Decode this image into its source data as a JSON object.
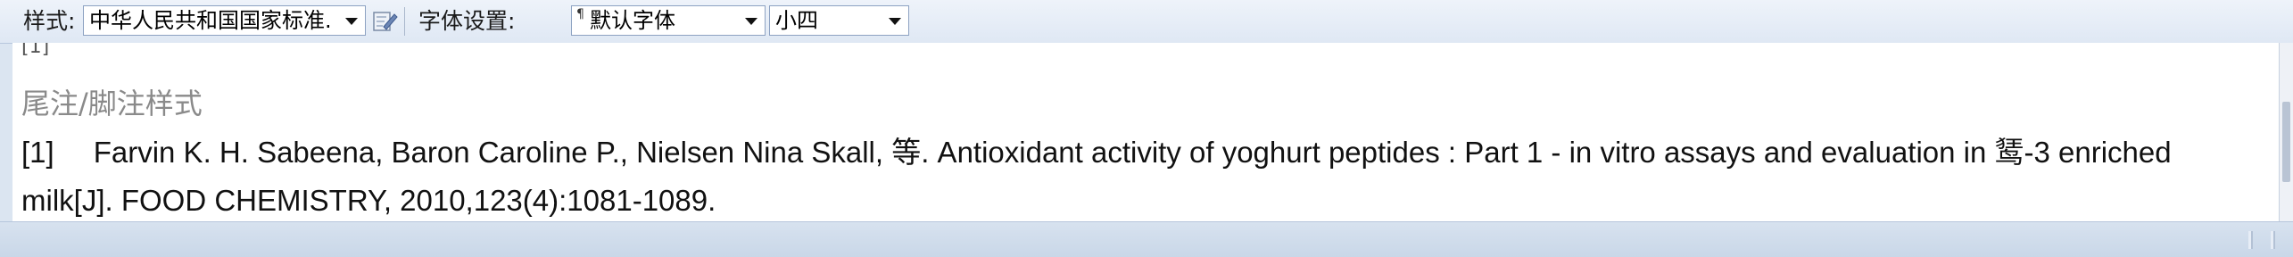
{
  "toolbar": {
    "style_label": "样式:",
    "style_value": "中华人民共和国国家标准.",
    "font_settings_label": "字体设置:",
    "font_value": "默认字体",
    "size_value": "小四"
  },
  "content": {
    "clipped_text": "[1]",
    "section_title": "尾注/脚注样式",
    "reference": {
      "number": "[1]",
      "text": "Farvin K. H. Sabeena, Baron Caroline P., Nielsen Nina Skall, 等. Antioxidant activity of yoghurt peptides : Part 1 - in vitro assays and evaluation in 𫛭-3 enriched milk[J]. FOOD CHEMISTRY, 2010,123(4):1081-1089."
    }
  },
  "icons": {
    "edit_style": "edit-style-icon",
    "font_type": "font-type-icon",
    "dropdown": "chevron-down-icon"
  }
}
